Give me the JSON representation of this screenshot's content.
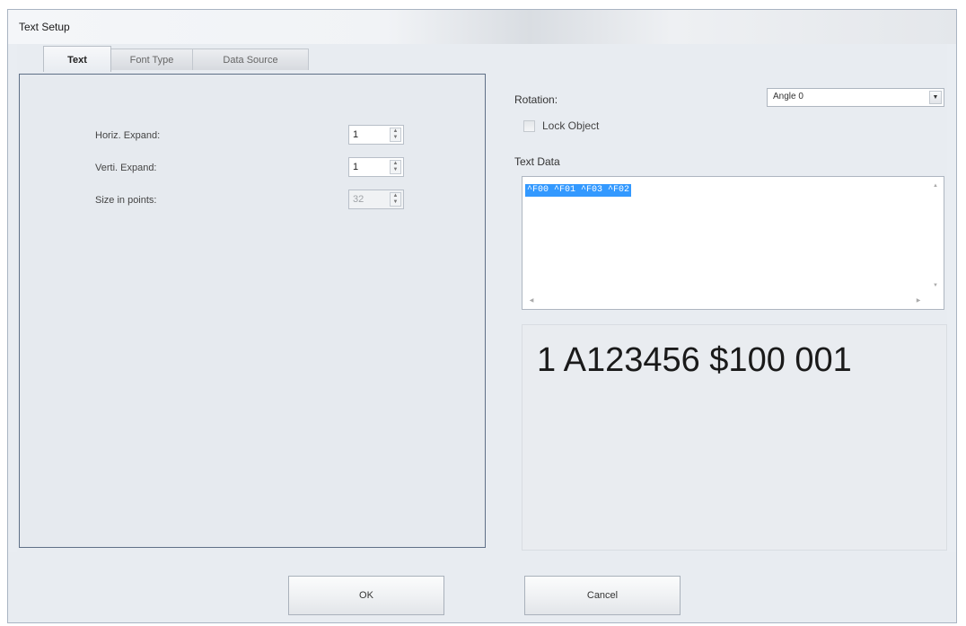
{
  "window": {
    "title": "Text Setup"
  },
  "tabs": [
    {
      "label": "Text",
      "active": true
    },
    {
      "label": "Font Type",
      "active": false
    },
    {
      "label": "Data Source",
      "active": false
    }
  ],
  "text_tab": {
    "horiz_expand_label": "Horiz. Expand:",
    "horiz_expand_value": "1",
    "verti_expand_label": "Verti. Expand:",
    "verti_expand_value": "1",
    "size_label": "Size in points:",
    "size_value": "32"
  },
  "rotation": {
    "label": "Rotation:",
    "value": "Angle 0"
  },
  "lock_object": {
    "label": "Lock Object",
    "checked": false
  },
  "text_data": {
    "label": "Text Data",
    "value": "^F00 ^F01 ^F03 ^F02"
  },
  "preview": {
    "text": "1 A123456  $100 001"
  },
  "buttons": {
    "ok": "OK",
    "cancel": "Cancel"
  },
  "icons": {
    "spin_up": "up-arrow-icon",
    "spin_down": "down-arrow-icon",
    "dropdown": "chevron-down-icon"
  }
}
